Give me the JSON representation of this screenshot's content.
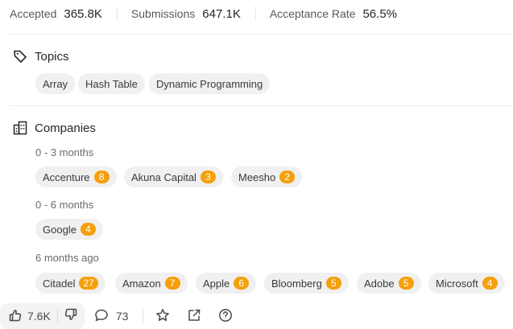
{
  "stats": {
    "accepted_label": "Accepted",
    "accepted_value": "365.8K",
    "submissions_label": "Submissions",
    "submissions_value": "647.1K",
    "acceptance_label": "Acceptance Rate",
    "acceptance_value": "56.5%"
  },
  "topics": {
    "title": "Topics",
    "icon": "tag-icon",
    "items": [
      "Array",
      "Hash Table",
      "Dynamic Programming"
    ]
  },
  "companies": {
    "title": "Companies",
    "icon": "building-icon",
    "groups": [
      {
        "period": "0 - 3 months",
        "items": [
          {
            "name": "Accenture",
            "count": "8"
          },
          {
            "name": "Akuna Capital",
            "count": "3"
          },
          {
            "name": "Meesho",
            "count": "2"
          }
        ]
      },
      {
        "period": "0 - 6 months",
        "items": [
          {
            "name": "Google",
            "count": "4"
          }
        ]
      },
      {
        "period": "6 months ago",
        "items": [
          {
            "name": "Citadel",
            "count": "27"
          },
          {
            "name": "Amazon",
            "count": "7"
          },
          {
            "name": "Apple",
            "count": "6"
          },
          {
            "name": "Bloomberg",
            "count": "5"
          },
          {
            "name": "Adobe",
            "count": "5"
          },
          {
            "name": "Microsoft",
            "count": "4"
          }
        ]
      }
    ],
    "badge_color": "#f59f0a"
  },
  "toolbar": {
    "likes": "7.6K",
    "comments": "73",
    "icons": [
      "thumbs-up-icon",
      "thumbs-down-icon",
      "comment-icon",
      "star-icon",
      "share-icon",
      "help-icon"
    ]
  }
}
